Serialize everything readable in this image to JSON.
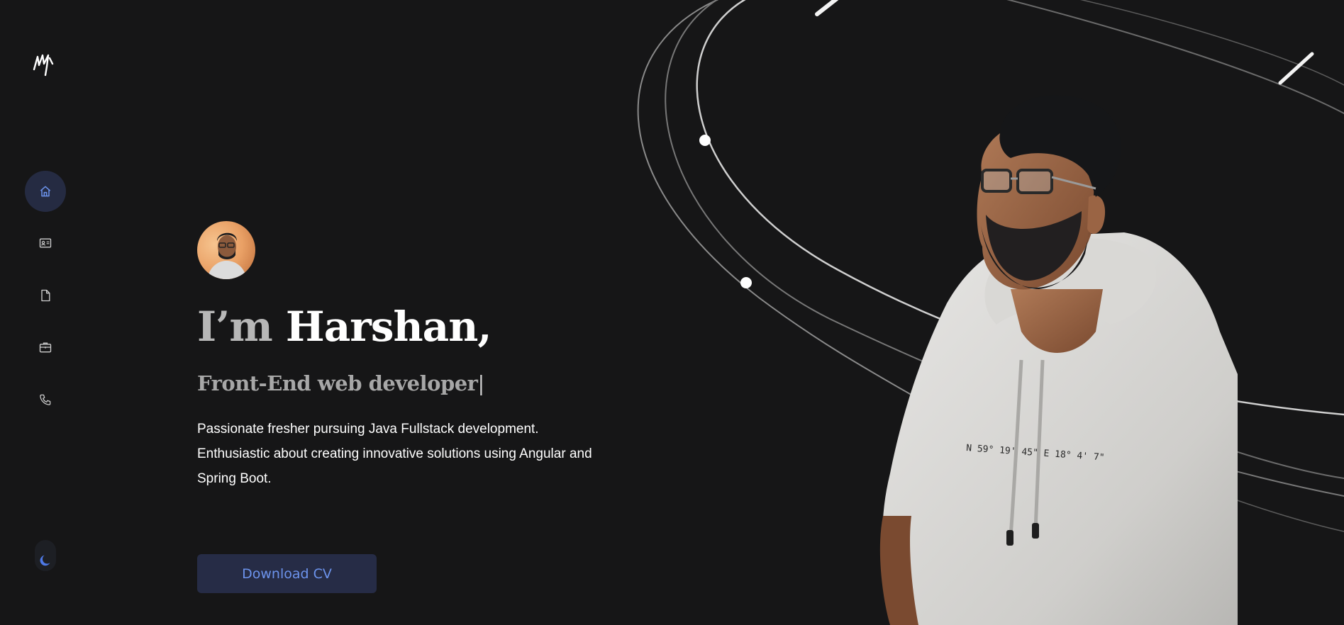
{
  "sidebar": {
    "logo": {
      "icon": "signature-logo"
    },
    "nav": [
      {
        "id": "home",
        "icon": "home-icon",
        "active": true
      },
      {
        "id": "about",
        "icon": "id-card-icon",
        "active": false
      },
      {
        "id": "resume",
        "icon": "document-icon",
        "active": false
      },
      {
        "id": "work",
        "icon": "briefcase-icon",
        "active": false
      },
      {
        "id": "contact",
        "icon": "phone-icon",
        "active": false
      }
    ],
    "theme_toggle": {
      "icon": "moon-icon",
      "mode": "dark"
    }
  },
  "hero": {
    "greeting": "I’m",
    "name": "Harshan,",
    "role": "Front-End web developer",
    "cursor": "|",
    "bio": "Passionate fresher pursuing Java Fullstack development. Enthusiastic about creating innovative solutions using Angular and Spring Boot.",
    "cta_label": "Download CV",
    "shirt_text": "N 59° 19' 45\" E 18° 4' 7\""
  },
  "colors": {
    "background": "#161617",
    "accent": "#6c93ec",
    "accent_bg": "#262c46",
    "text_primary": "#ffffff",
    "text_muted": "#a7a7a7"
  }
}
